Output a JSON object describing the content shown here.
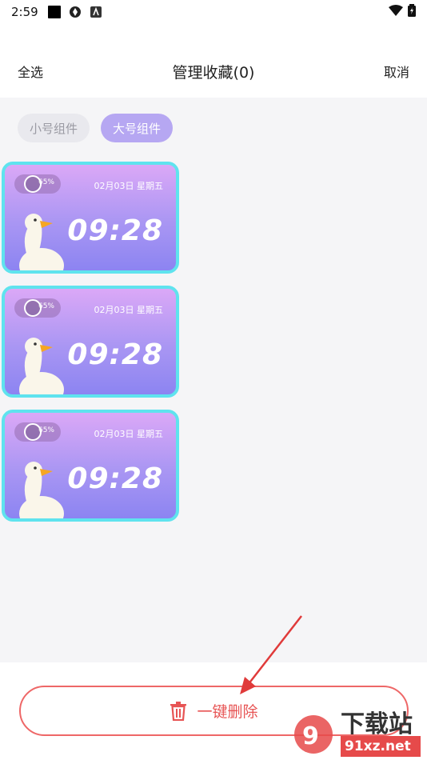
{
  "status_bar": {
    "time": "2:59"
  },
  "header": {
    "select_all": "全选",
    "title": "管理收藏(0)",
    "cancel": "取消"
  },
  "tabs": [
    {
      "label": "小号组件",
      "active": false
    },
    {
      "label": "大号组件",
      "active": true
    }
  ],
  "widgets": [
    {
      "battery": "65%",
      "date": "02月03日 星期五",
      "time": "09:28"
    },
    {
      "battery": "65%",
      "date": "02月03日 星期五",
      "time": "09:28"
    },
    {
      "battery": "65%",
      "date": "02月03日 星期五",
      "time": "09:28"
    }
  ],
  "actions": {
    "delete_label": "一键删除"
  },
  "watermark": {
    "brand": "下载站",
    "domain": "91xz.net"
  },
  "colors": {
    "accent_border": "#5fe3ee",
    "active_tab": "#b6a7f2",
    "delete_red": "#e75454"
  }
}
